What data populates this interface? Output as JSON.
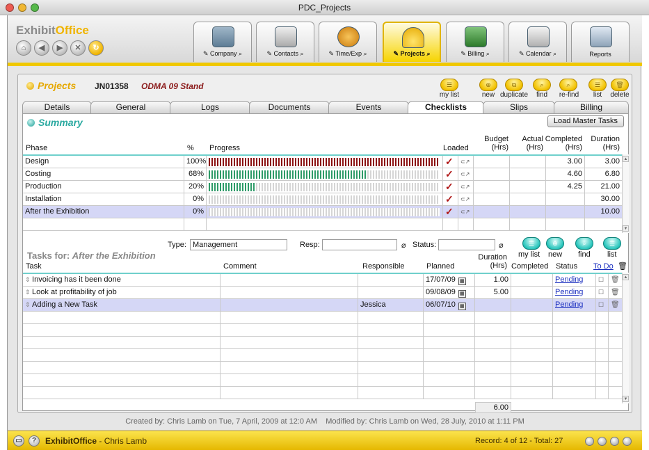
{
  "window": {
    "title": "PDC_Projects"
  },
  "app": {
    "logo_part1": "Exhibit",
    "logo_part2": "Office"
  },
  "top_tabs": [
    {
      "label": "Company",
      "icon": "building-icon"
    },
    {
      "label": "Contacts",
      "icon": "rolodex-icon"
    },
    {
      "label": "Time/Exp",
      "icon": "clock-icon"
    },
    {
      "label": "Projects",
      "icon": "hardhat-icon",
      "active": true
    },
    {
      "label": "Billing",
      "icon": "money-icon"
    },
    {
      "label": "Calendar",
      "icon": "calendar-icon"
    },
    {
      "label": "Reports",
      "icon": "reports-icon"
    }
  ],
  "project": {
    "module": "Projects",
    "id": "JN01358",
    "name": "ODMA 09 Stand"
  },
  "toolbar": {
    "my_list": "my list",
    "new": "new",
    "duplicate": "duplicate",
    "find": "find",
    "refind": "re-find",
    "list": "list",
    "delete": "delete"
  },
  "subtabs": [
    "Details",
    "General",
    "Logs",
    "Documents",
    "Events",
    "Checklists",
    "Slips",
    "Billing"
  ],
  "summary": {
    "title": "Summary",
    "load_master_button": "Load Master Tasks",
    "headers": {
      "phase": "Phase",
      "pct": "%",
      "progress": "Progress",
      "loaded": "Loaded",
      "budget": "Budget",
      "budget_unit": "(Hrs)",
      "actual": "Actual",
      "actual_unit": "(Hrs)",
      "completed": "Completed",
      "completed_unit": "(Hrs)",
      "duration": "Duration",
      "duration_unit": "(Hrs)"
    },
    "rows": [
      {
        "phase": "Design",
        "pct": "100%",
        "progress": 1.0,
        "completed": "3.00",
        "duration": "3.00"
      },
      {
        "phase": "Costing",
        "pct": "68%",
        "progress": 0.68,
        "completed": "4.60",
        "duration": "6.80"
      },
      {
        "phase": "Production",
        "pct": "20%",
        "progress": 0.2,
        "completed": "4.25",
        "duration": "21.00"
      },
      {
        "phase": "Installation",
        "pct": "0%",
        "progress": 0.0,
        "completed": "",
        "duration": "30.00"
      },
      {
        "phase": "After the Exhibition",
        "pct": "0%",
        "progress": 0.0,
        "completed": "",
        "duration": "10.00",
        "selected": true
      }
    ]
  },
  "filters": {
    "type_label": "Type:",
    "type_value": "Management",
    "resp_label": "Resp:",
    "resp_value": "",
    "status_label": "Status:",
    "status_value": ""
  },
  "task_toolbar": {
    "my_list": "my list",
    "new": "new",
    "find": "find",
    "list": "list"
  },
  "tasks": {
    "title_prefix": "Tasks for:",
    "title_phase": "After the Exhibition",
    "headers": {
      "task": "Task",
      "comment": "Comment",
      "responsible": "Responsible",
      "planned": "Planned",
      "duration": "Duration",
      "duration_unit": "(Hrs)",
      "completed": "Completed",
      "status": "Status",
      "todo": "To Do"
    },
    "rows": [
      {
        "task": "Invoicing has it been done",
        "comment": "",
        "responsible": "",
        "planned": "17/07/09",
        "duration": "1.00",
        "completed": "",
        "status": "Pending"
      },
      {
        "task": "Look at profitability of job",
        "comment": "",
        "responsible": "",
        "planned": "09/08/09",
        "duration": "5.00",
        "completed": "",
        "status": "Pending"
      },
      {
        "task": "Adding a New Task",
        "comment": "",
        "responsible": "Jessica",
        "planned": "06/07/10",
        "duration": "",
        "completed": "",
        "status": "Pending",
        "selected": true
      }
    ],
    "total_duration": "6.00"
  },
  "footer": {
    "created": "Created by: Chris Lamb on Tue, 7 April, 2009 at 12:0 AM",
    "modified": "Modified by: Chris Lamb on Wed, 28 July, 2010 at 1:11 PM"
  },
  "statusbar": {
    "app": "ExhibitOffice",
    "user": "Chris Lamb",
    "records": "Record: 4 of 12 - Total: 27"
  },
  "colors": {
    "accent": "#f0c800",
    "progress_full": "#8b1010",
    "progress_partial": "#2e9b68",
    "selected_row": "#d5d7f6",
    "summary_title": "#2aa9a0"
  }
}
